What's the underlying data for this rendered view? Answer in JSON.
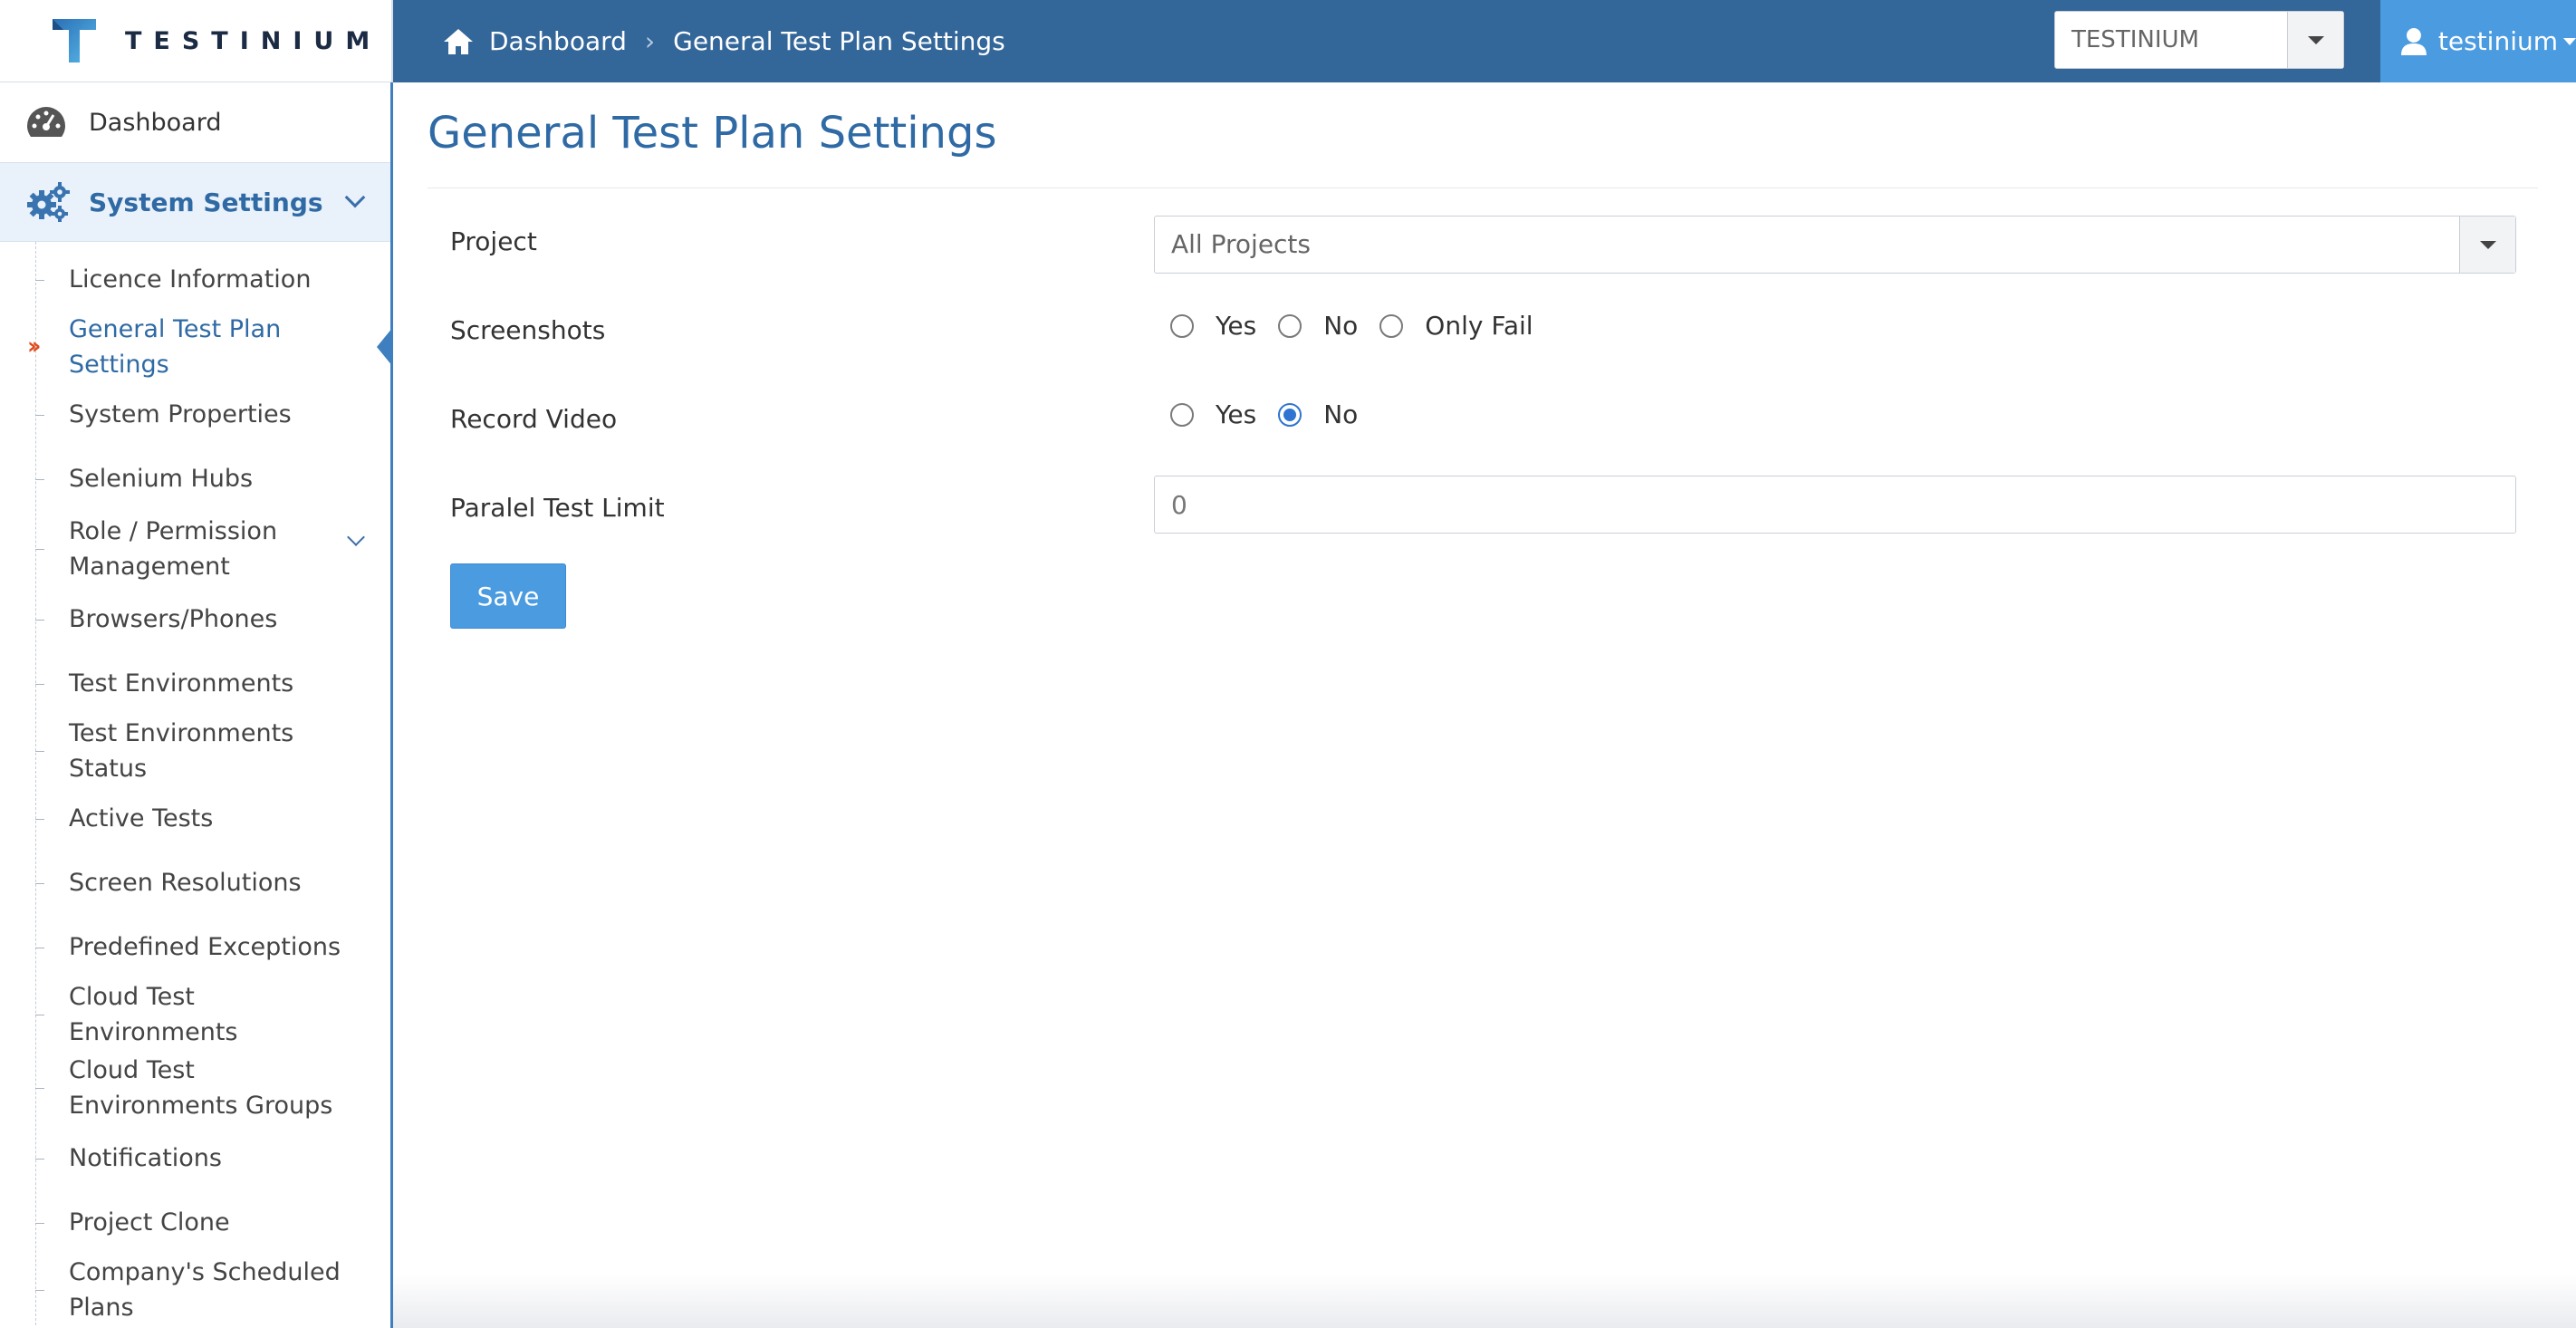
{
  "brand": {
    "name": "TESTINIUM",
    "colors": {
      "primary": "#336699",
      "accent": "#4b9be0",
      "active_marker": "#e04a1c"
    }
  },
  "header": {
    "breadcrumb": {
      "home": "Dashboard",
      "current": "General Test Plan Settings"
    },
    "org_select": {
      "value": "TESTINIUM"
    },
    "user": {
      "name": "testinium"
    }
  },
  "sidebar": {
    "dashboard": "Dashboard",
    "system_settings": "System Settings",
    "items": [
      {
        "label": "Licence Information"
      },
      {
        "label": "General Test Plan Settings"
      },
      {
        "label": "System Properties"
      },
      {
        "label": "Selenium Hubs"
      },
      {
        "label": "Role / Permission Management"
      },
      {
        "label": "Browsers/Phones"
      },
      {
        "label": "Test Environments"
      },
      {
        "label": "Test Environments Status"
      },
      {
        "label": "Active Tests"
      },
      {
        "label": "Screen Resolutions"
      },
      {
        "label": "Predefined Exceptions"
      },
      {
        "label": "Cloud Test Environments"
      },
      {
        "label": "Cloud Test Environments Groups"
      },
      {
        "label": "Notifications"
      },
      {
        "label": "Project Clone"
      },
      {
        "label": "Company's Scheduled Plans"
      }
    ]
  },
  "main": {
    "title": "General Test Plan Settings",
    "form": {
      "project_label": "Project",
      "project_value": "All Projects",
      "screenshots_label": "Screenshots",
      "screenshots_options": [
        "Yes",
        "No",
        "Only Fail"
      ],
      "screenshots_selected": null,
      "record_video_label": "Record Video",
      "record_video_options": [
        "Yes",
        "No"
      ],
      "record_video_selected": "No",
      "parallel_limit_label": "Paralel Test Limit",
      "parallel_limit_value": "0",
      "save_label": "Save"
    }
  }
}
